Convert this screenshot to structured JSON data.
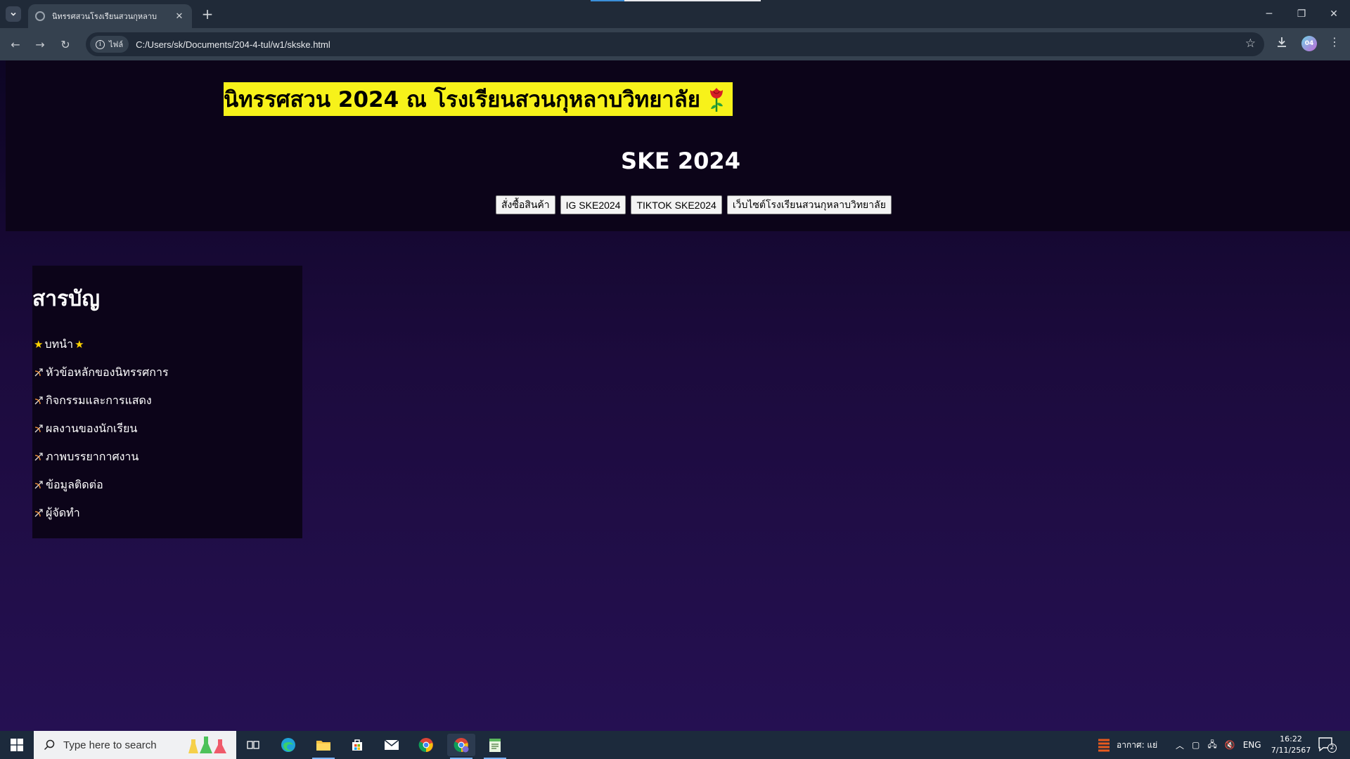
{
  "browser": {
    "tab_title": "นิทรรศสวนโรงเรียนสวนกุหลาบ",
    "site_chip": "ไฟล์",
    "url": "C:/Users/sk/Documents/204-4-tul/w1/skske.html",
    "profile_initials": "04"
  },
  "page": {
    "banner_text": "นิทรรศสวน 2024 ณ โรงเรียนสวนกุหลาบวิทยาลัย",
    "heading": "SKE 2024",
    "nav_buttons": [
      {
        "label": "สั่งซื้อสินค้า"
      },
      {
        "label": "IG SKE2024"
      },
      {
        "label": "TIKTOK SKE2024"
      },
      {
        "label": "เว็บไซต์โรงเรียนสวนกุหลาบวิทยาลัย"
      }
    ],
    "toc": {
      "title": "สารบัญ",
      "intro_label": "บทนำ",
      "items": [
        {
          "label": "หัวข้อหลักของนิทรรศการ"
        },
        {
          "label": "กิจกรรมและการแสดง"
        },
        {
          "label": "ผลงานของนักเรียน"
        },
        {
          "label": "ภาพบรรยากาศงาน"
        },
        {
          "label": "ข้อมูลติดต่อ"
        },
        {
          "label": "ผู้จัดทำ"
        }
      ]
    }
  },
  "taskbar": {
    "search_placeholder": "Type here to search",
    "weather_text": "อากาศ: แย่",
    "language": "ENG",
    "time": "16:22",
    "date": "7/11/2567",
    "notification_count": "2"
  },
  "colors": {
    "banner_bg": "#f7f21a",
    "header_band": "#0c0419",
    "page_bg": "#200c45"
  }
}
